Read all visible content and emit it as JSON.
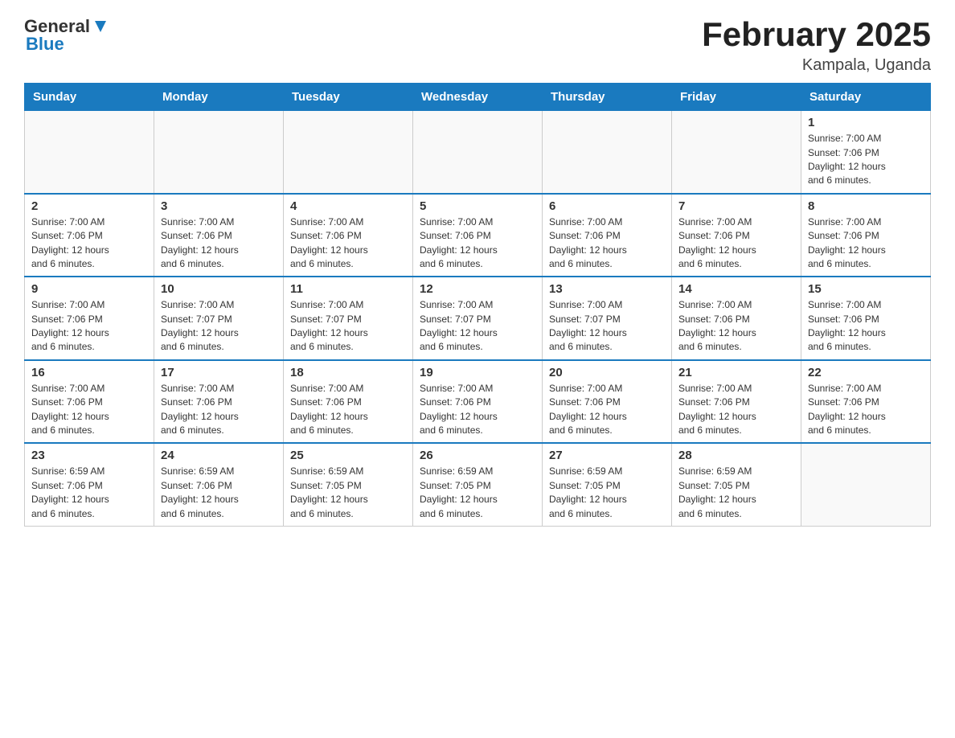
{
  "header": {
    "logo": {
      "general": "General",
      "blue": "Blue"
    },
    "title": "February 2025",
    "location": "Kampala, Uganda"
  },
  "days_of_week": [
    "Sunday",
    "Monday",
    "Tuesday",
    "Wednesday",
    "Thursday",
    "Friday",
    "Saturday"
  ],
  "weeks": [
    {
      "days": [
        {
          "num": "",
          "info": ""
        },
        {
          "num": "",
          "info": ""
        },
        {
          "num": "",
          "info": ""
        },
        {
          "num": "",
          "info": ""
        },
        {
          "num": "",
          "info": ""
        },
        {
          "num": "",
          "info": ""
        },
        {
          "num": "1",
          "info": "Sunrise: 7:00 AM\nSunset: 7:06 PM\nDaylight: 12 hours\nand 6 minutes."
        }
      ]
    },
    {
      "days": [
        {
          "num": "2",
          "info": "Sunrise: 7:00 AM\nSunset: 7:06 PM\nDaylight: 12 hours\nand 6 minutes."
        },
        {
          "num": "3",
          "info": "Sunrise: 7:00 AM\nSunset: 7:06 PM\nDaylight: 12 hours\nand 6 minutes."
        },
        {
          "num": "4",
          "info": "Sunrise: 7:00 AM\nSunset: 7:06 PM\nDaylight: 12 hours\nand 6 minutes."
        },
        {
          "num": "5",
          "info": "Sunrise: 7:00 AM\nSunset: 7:06 PM\nDaylight: 12 hours\nand 6 minutes."
        },
        {
          "num": "6",
          "info": "Sunrise: 7:00 AM\nSunset: 7:06 PM\nDaylight: 12 hours\nand 6 minutes."
        },
        {
          "num": "7",
          "info": "Sunrise: 7:00 AM\nSunset: 7:06 PM\nDaylight: 12 hours\nand 6 minutes."
        },
        {
          "num": "8",
          "info": "Sunrise: 7:00 AM\nSunset: 7:06 PM\nDaylight: 12 hours\nand 6 minutes."
        }
      ]
    },
    {
      "days": [
        {
          "num": "9",
          "info": "Sunrise: 7:00 AM\nSunset: 7:06 PM\nDaylight: 12 hours\nand 6 minutes."
        },
        {
          "num": "10",
          "info": "Sunrise: 7:00 AM\nSunset: 7:07 PM\nDaylight: 12 hours\nand 6 minutes."
        },
        {
          "num": "11",
          "info": "Sunrise: 7:00 AM\nSunset: 7:07 PM\nDaylight: 12 hours\nand 6 minutes."
        },
        {
          "num": "12",
          "info": "Sunrise: 7:00 AM\nSunset: 7:07 PM\nDaylight: 12 hours\nand 6 minutes."
        },
        {
          "num": "13",
          "info": "Sunrise: 7:00 AM\nSunset: 7:07 PM\nDaylight: 12 hours\nand 6 minutes."
        },
        {
          "num": "14",
          "info": "Sunrise: 7:00 AM\nSunset: 7:06 PM\nDaylight: 12 hours\nand 6 minutes."
        },
        {
          "num": "15",
          "info": "Sunrise: 7:00 AM\nSunset: 7:06 PM\nDaylight: 12 hours\nand 6 minutes."
        }
      ]
    },
    {
      "days": [
        {
          "num": "16",
          "info": "Sunrise: 7:00 AM\nSunset: 7:06 PM\nDaylight: 12 hours\nand 6 minutes."
        },
        {
          "num": "17",
          "info": "Sunrise: 7:00 AM\nSunset: 7:06 PM\nDaylight: 12 hours\nand 6 minutes."
        },
        {
          "num": "18",
          "info": "Sunrise: 7:00 AM\nSunset: 7:06 PM\nDaylight: 12 hours\nand 6 minutes."
        },
        {
          "num": "19",
          "info": "Sunrise: 7:00 AM\nSunset: 7:06 PM\nDaylight: 12 hours\nand 6 minutes."
        },
        {
          "num": "20",
          "info": "Sunrise: 7:00 AM\nSunset: 7:06 PM\nDaylight: 12 hours\nand 6 minutes."
        },
        {
          "num": "21",
          "info": "Sunrise: 7:00 AM\nSunset: 7:06 PM\nDaylight: 12 hours\nand 6 minutes."
        },
        {
          "num": "22",
          "info": "Sunrise: 7:00 AM\nSunset: 7:06 PM\nDaylight: 12 hours\nand 6 minutes."
        }
      ]
    },
    {
      "days": [
        {
          "num": "23",
          "info": "Sunrise: 6:59 AM\nSunset: 7:06 PM\nDaylight: 12 hours\nand 6 minutes."
        },
        {
          "num": "24",
          "info": "Sunrise: 6:59 AM\nSunset: 7:06 PM\nDaylight: 12 hours\nand 6 minutes."
        },
        {
          "num": "25",
          "info": "Sunrise: 6:59 AM\nSunset: 7:05 PM\nDaylight: 12 hours\nand 6 minutes."
        },
        {
          "num": "26",
          "info": "Sunrise: 6:59 AM\nSunset: 7:05 PM\nDaylight: 12 hours\nand 6 minutes."
        },
        {
          "num": "27",
          "info": "Sunrise: 6:59 AM\nSunset: 7:05 PM\nDaylight: 12 hours\nand 6 minutes."
        },
        {
          "num": "28",
          "info": "Sunrise: 6:59 AM\nSunset: 7:05 PM\nDaylight: 12 hours\nand 6 minutes."
        },
        {
          "num": "",
          "info": ""
        }
      ]
    }
  ]
}
